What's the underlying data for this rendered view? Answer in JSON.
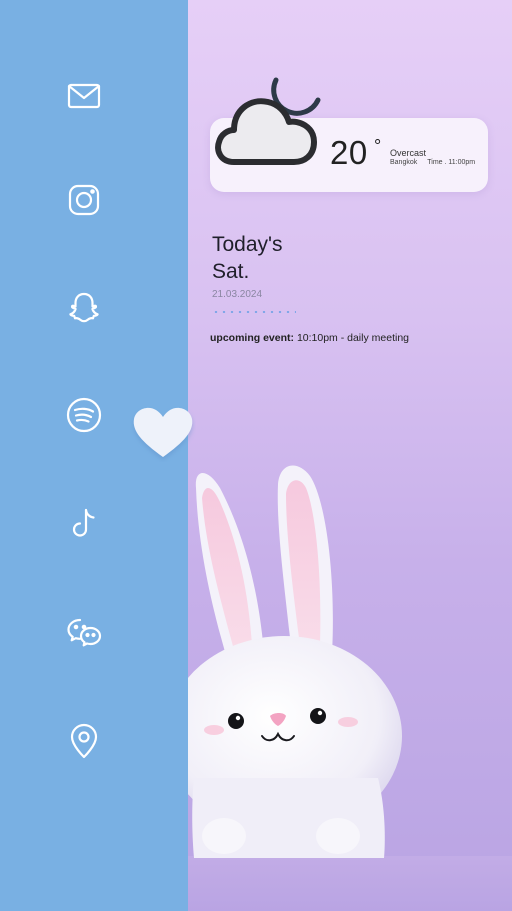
{
  "sidebar": {
    "icons": [
      {
        "name": "mail-icon"
      },
      {
        "name": "instagram-icon"
      },
      {
        "name": "snapchat-icon"
      },
      {
        "name": "spotify-icon"
      },
      {
        "name": "tiktok-icon"
      },
      {
        "name": "wechat-icon"
      },
      {
        "name": "location-icon"
      }
    ]
  },
  "weather": {
    "temperature": "20",
    "degree_symbol": "°",
    "condition": "Overcast",
    "location": "Bangkok",
    "time": "Time . 11:00pm",
    "icon": "cloud-moon-icon"
  },
  "today": {
    "heading_line1": "Today's",
    "heading_line2": "Sat.",
    "date": "21.03.2024"
  },
  "event": {
    "label": "upcoming event:",
    "detail": "10:10pm - daily meeting"
  },
  "colors": {
    "sidebar": "#79b0e3",
    "background_top": "#e6cff7",
    "background_bottom": "#b9a4e3"
  }
}
